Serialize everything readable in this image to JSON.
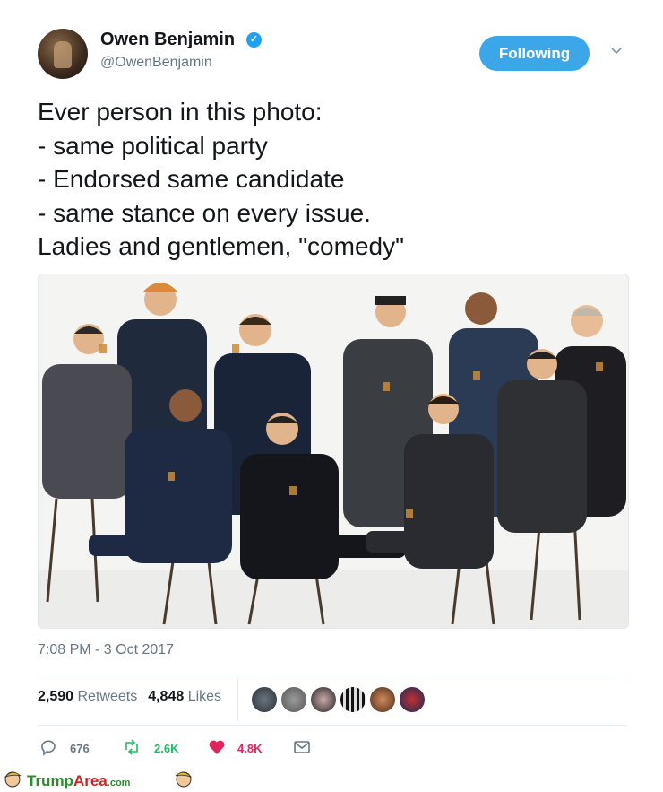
{
  "tweet": {
    "author_name": "Owen Benjamin",
    "handle": "@OwenBenjamin",
    "follow_label": "Following",
    "text": "Ever person in this photo:\n- same political party\n- Endorsed same candidate\n- same stance on every issue.\nLadies and gentlemen, \"comedy\"",
    "timestamp": "7:08 PM - 3 Oct 2017",
    "retweets_count": "2,590",
    "retweets_label": "Retweets",
    "likes_count": "4,848",
    "likes_label": "Likes",
    "reply_count": "676",
    "retweet_action_count": "2.6K",
    "like_action_count": "4.8K"
  },
  "colors": {
    "accent": "#1da1f2",
    "follow_button": "#3ba7e9",
    "retweet_green": "#17bf63",
    "like_red": "#e0245e",
    "muted": "#657786"
  },
  "icons": {
    "verified": "verified-badge-icon",
    "more": "chevron-down-icon",
    "reply": "reply-icon",
    "retweet": "retweet-icon",
    "like": "heart-icon",
    "dm": "mail-icon"
  },
  "footer": {
    "brand_part1": "Trump",
    "brand_part2": "Area",
    "brand_part3": ".com"
  }
}
